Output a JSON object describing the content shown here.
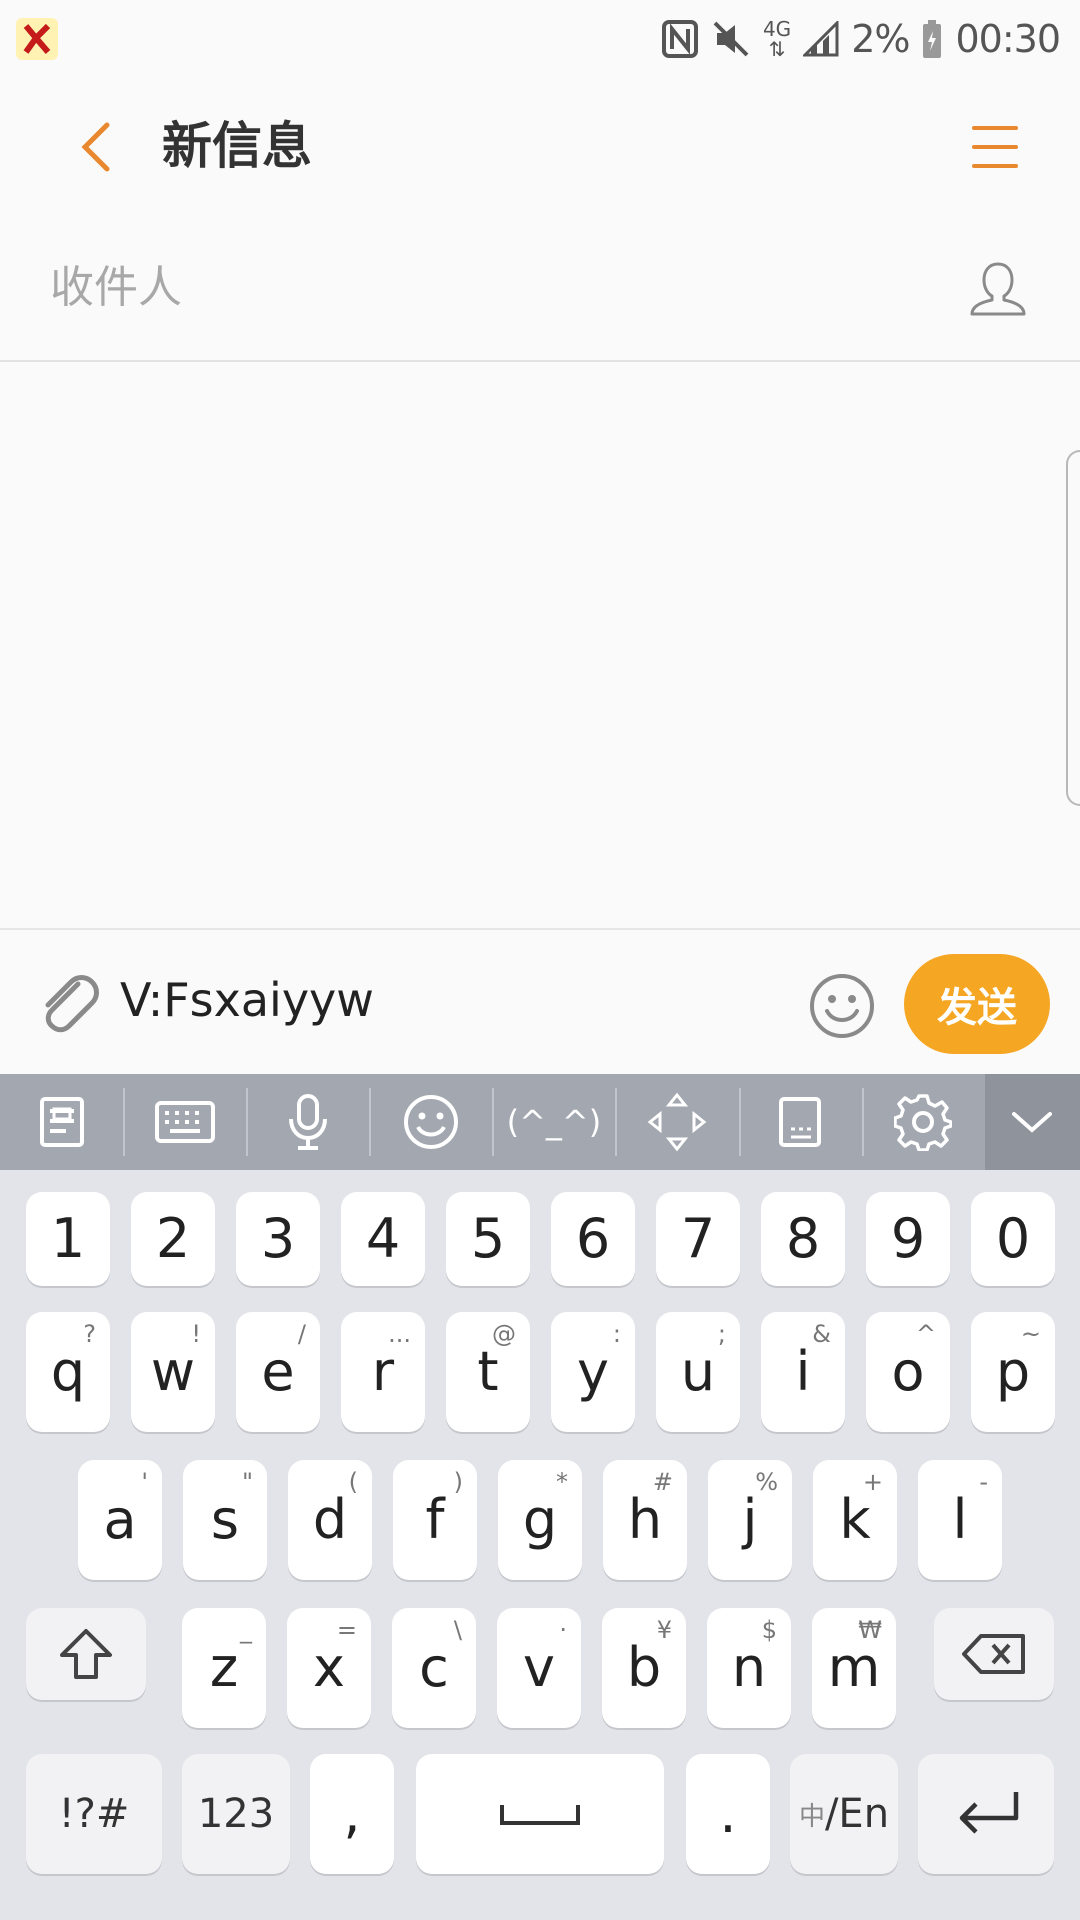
{
  "status_bar": {
    "battery": "2%",
    "time": "00:30",
    "network": "4G"
  },
  "header": {
    "title": "新信息"
  },
  "recipient": {
    "placeholder": "收件人"
  },
  "compose": {
    "message": "V:Fsxaiyyw",
    "send_label": "发送"
  },
  "toolbar": {
    "emoticon": "(^_^)"
  },
  "keyboard": {
    "numbers": [
      "1",
      "2",
      "3",
      "4",
      "5",
      "6",
      "7",
      "8",
      "9",
      "0"
    ],
    "row1": [
      {
        "main": "q",
        "sub": "?"
      },
      {
        "main": "w",
        "sub": "!"
      },
      {
        "main": "e",
        "sub": "/"
      },
      {
        "main": "r",
        "sub": "..."
      },
      {
        "main": "t",
        "sub": "@"
      },
      {
        "main": "y",
        "sub": ":"
      },
      {
        "main": "u",
        "sub": ";"
      },
      {
        "main": "i",
        "sub": "&"
      },
      {
        "main": "o",
        "sub": "^"
      },
      {
        "main": "p",
        "sub": "~"
      }
    ],
    "row2": [
      {
        "main": "a",
        "sub": "'"
      },
      {
        "main": "s",
        "sub": "\""
      },
      {
        "main": "d",
        "sub": "("
      },
      {
        "main": "f",
        "sub": ")"
      },
      {
        "main": "g",
        "sub": "*"
      },
      {
        "main": "h",
        "sub": "#"
      },
      {
        "main": "j",
        "sub": "%"
      },
      {
        "main": "k",
        "sub": "+"
      },
      {
        "main": "l",
        "sub": "-"
      }
    ],
    "row3": [
      {
        "main": "z",
        "sub": "_"
      },
      {
        "main": "x",
        "sub": "="
      },
      {
        "main": "c",
        "sub": "\\"
      },
      {
        "main": "v",
        "sub": "·"
      },
      {
        "main": "b",
        "sub": "¥"
      },
      {
        "main": "n",
        "sub": "$"
      },
      {
        "main": "m",
        "sub": "₩"
      }
    ],
    "symbols_label": "!?#",
    "numbers_label": "123",
    "comma": ",",
    "period": ".",
    "lang_prefix": "中",
    "lang_suffix": "/En"
  },
  "colors": {
    "accent": "#e8892f",
    "send": "#f5a623",
    "toolbar": "#a3a7b0",
    "keyboard_bg": "#e3e4e9"
  }
}
